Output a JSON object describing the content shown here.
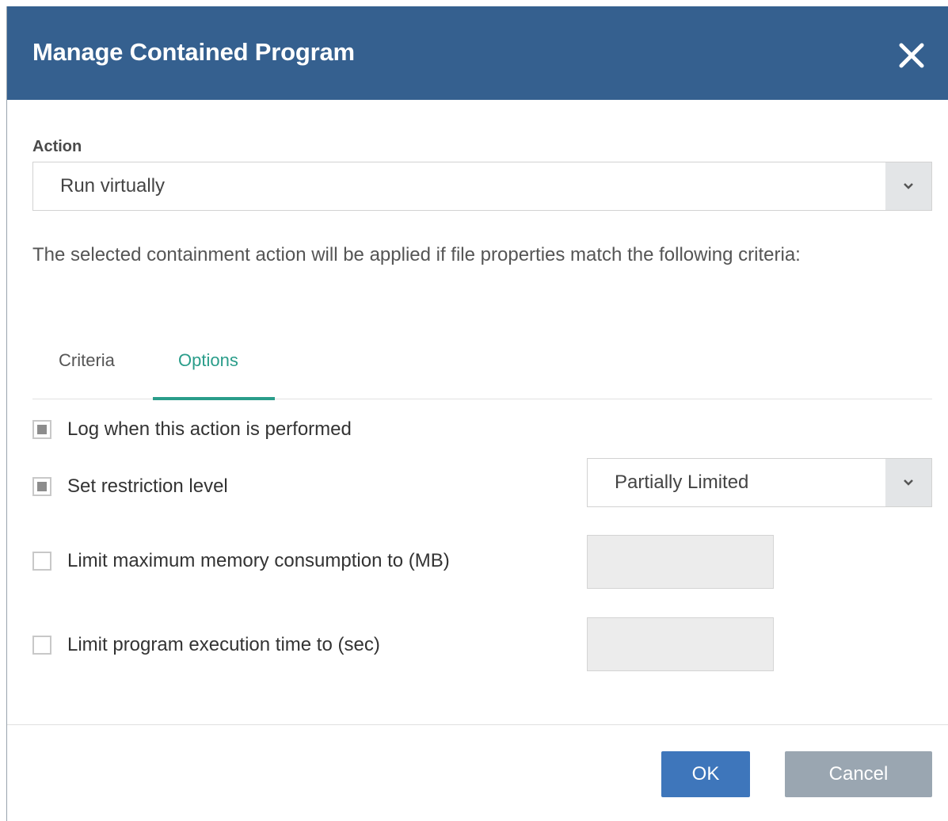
{
  "dialog": {
    "title": "Manage Contained Program",
    "close_icon": "close-icon"
  },
  "action": {
    "label": "Action",
    "selected": "Run virtually",
    "arrow_icon": "chevron-down-icon"
  },
  "description": "The selected containment action will be applied if file properties match the following criteria:",
  "tabs": [
    {
      "label": "Criteria",
      "active": false
    },
    {
      "label": "Options",
      "active": true
    }
  ],
  "options": {
    "log": {
      "label": "Log when this action is performed",
      "checked": true
    },
    "restriction": {
      "label": "Set restriction level",
      "checked": true,
      "selected": "Partially Limited"
    },
    "memory": {
      "label": "Limit maximum memory consumption to (MB)",
      "checked": false,
      "value": ""
    },
    "execution": {
      "label": "Limit program execution time to (sec)",
      "checked": false,
      "value": ""
    }
  },
  "buttons": {
    "ok": "OK",
    "cancel": "Cancel"
  },
  "colors": {
    "header": "#35608f",
    "accent": "#2a9d8a",
    "ok": "#3e76bb",
    "cancel": "#9aa6b1"
  }
}
